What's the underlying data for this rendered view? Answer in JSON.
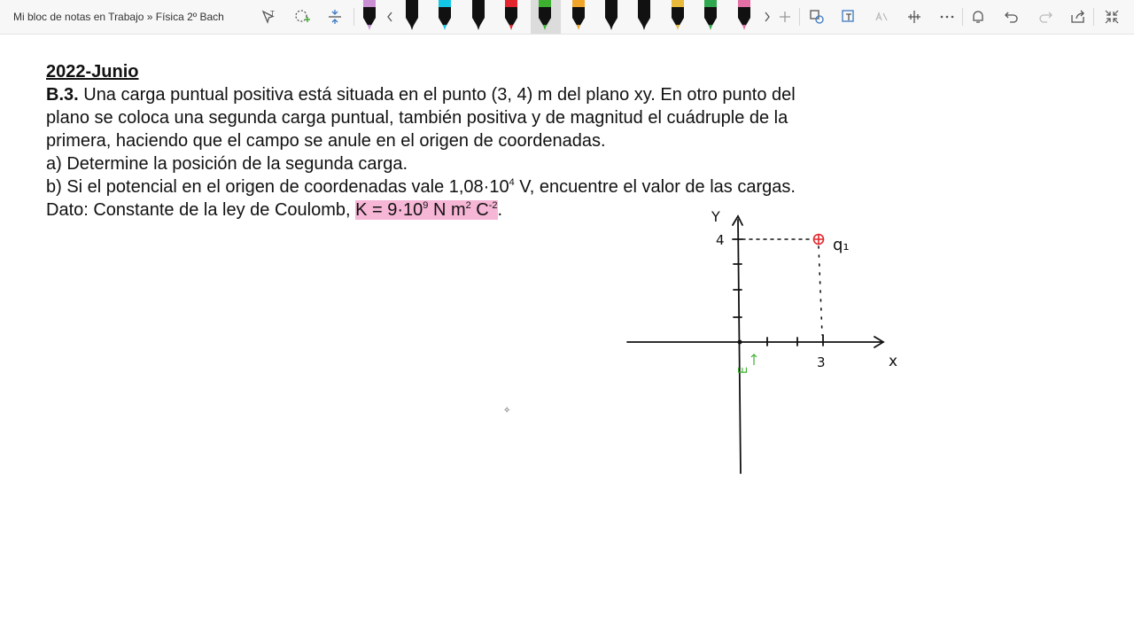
{
  "toolbar": {
    "breadcrumb": "Mi bloc de notas en Trabajo » Física 2º Bach",
    "colors": {
      "pens": [
        "#c88fd2",
        "#111111",
        "#14c6e6",
        "#111111",
        "#e3262d",
        "#3db030",
        "#f0a52a",
        "#111111",
        "#111111",
        "#e8b93a",
        "#2fa84f",
        "#e36fa5",
        "#111111"
      ]
    }
  },
  "content": {
    "heading": "2022-Junio",
    "problem_number": "B.3.",
    "line1": " Una carga puntual positiva está situada en el punto (3, 4) m del plano xy. En otro punto del",
    "line2": "plano se coloca una segunda carga puntual, también positiva y de magnitud el cuádruple de la",
    "line3": "primera, haciendo que el campo se anule en el origen de coordenadas.",
    "part_a": "a) Determine la posición de la segunda carga.",
    "part_b_pre": "b) Si el potencial en el origen de coordenadas vale 1,08·10",
    "part_b_exp": "4",
    "part_b_post": " V, encuentre el valor de las cargas.",
    "dato_pre": "Dato: Constante de la ley de Coulomb, ",
    "k_pre": "K = 9·10",
    "k_exp1": "9",
    "k_mid1": " N m",
    "k_exp2": "2",
    "k_mid2": " C",
    "k_exp3": "-2",
    "dato_post": ".",
    "highlight_color": "#f6b6d6"
  },
  "sketch": {
    "y_label": "Y",
    "x_label": "x",
    "y_tick": "4",
    "x_tick": "3",
    "charge_label": "q₁",
    "field_label": "E",
    "charge_color": "#e3262d",
    "field_color": "#3db030"
  }
}
